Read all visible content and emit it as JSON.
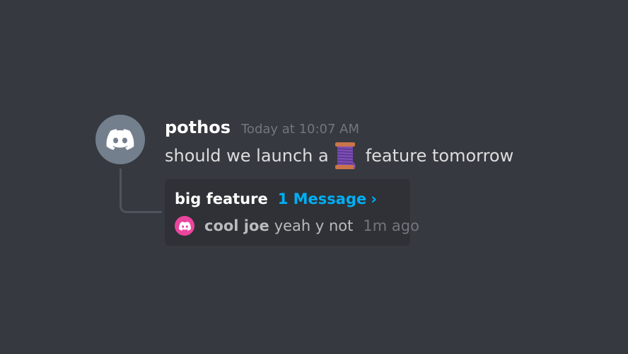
{
  "message": {
    "username": "pothos",
    "timestamp": "Today at 10:07 AM",
    "text_before": "should we launch a",
    "emoji": "spool-of-thread",
    "text_after": "feature tomorrow",
    "avatar_color": "#747f8d"
  },
  "thread": {
    "name": "big feature",
    "message_count": "1 Message",
    "chevron": "›",
    "last_reply": {
      "username": "cool joe",
      "text": "yeah y not",
      "time": "1m ago",
      "avatar_color": "#eb459e"
    }
  },
  "colors": {
    "background": "#36393f",
    "card": "#2f3136",
    "link": "#00aff4",
    "muted": "#72767d"
  }
}
